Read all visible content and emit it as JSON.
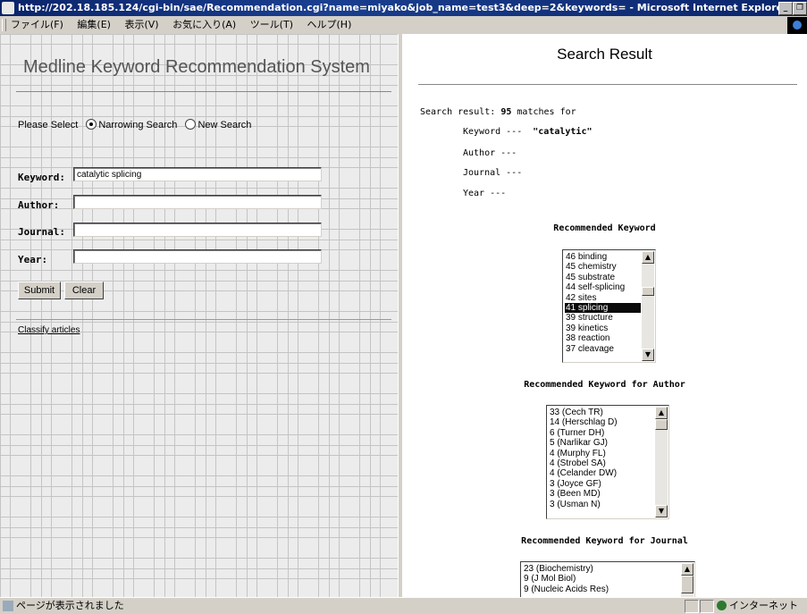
{
  "window": {
    "title": "http://202.18.185.124/cgi-bin/sae/Recommendation.cgi?name=miyako&job_name=test3&deep=2&keywords= - Microsoft Internet Explorer"
  },
  "menu": [
    "ファイル(F)",
    "編集(E)",
    "表示(V)",
    "お気に入り(A)",
    "ツール(T)",
    "ヘルプ(H)"
  ],
  "left": {
    "title": "Medline Keyword Recommendation System",
    "select_label": "Please Select",
    "radio_narrow": "Narrowing Search",
    "radio_new": "New Search",
    "keyword_label": "Keyword:",
    "keyword_value": "catalytic splicing",
    "author_label": "Author:",
    "author_value": "",
    "journal_label": "Journal:",
    "journal_value": "",
    "year_label": "Year:",
    "year_value": "",
    "submit": "Submit",
    "clear": "Clear",
    "classify_link": "Classify articles"
  },
  "right": {
    "title": "Search Result",
    "result_prefix": "Search result:",
    "match_count": "95",
    "result_suffix": "matches for",
    "keyword_label": "Keyword ---",
    "keyword_value": "\"catalytic\"",
    "author_label": "Author  ---",
    "journal_label": "Journal ---",
    "year_label": "Year   ---",
    "rec_keyword_heading": "Recommended Keyword",
    "rec_keywords": [
      "46 binding",
      "45 chemistry",
      "45 substrate",
      "44 self-splicing",
      "42 sites",
      "41 splicing",
      "39 structure",
      "39 kinetics",
      "38 reaction",
      "37 cleavage"
    ],
    "rec_keyword_selected": "41 splicing",
    "rec_author_heading": "Recommended Keyword for Author",
    "rec_authors": [
      "33 (Cech TR)",
      "14 (Herschlag D)",
      "6 (Turner DH)",
      "5 (Narlikar GJ)",
      "4 (Murphy FL)",
      "4 (Strobel SA)",
      "4 (Celander DW)",
      "3 (Joyce GF)",
      "3 (Been MD)",
      "3 (Usman N)"
    ],
    "rec_journal_heading": "Recommended Keyword for Journal",
    "rec_journals": [
      "23 (Biochemistry)",
      "9 (J Mol Biol)",
      "9 (Nucleic Acids Res)"
    ]
  },
  "status": {
    "text": "ページが表示されました",
    "zone": "インターネット"
  }
}
